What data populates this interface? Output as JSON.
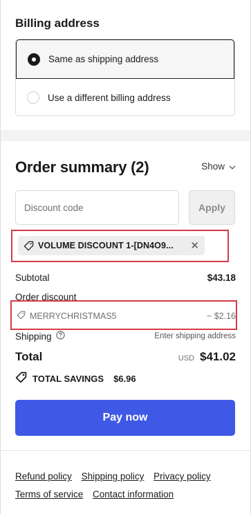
{
  "billing": {
    "title": "Billing address",
    "options": [
      {
        "label": "Same as shipping address",
        "selected": true
      },
      {
        "label": "Use a different billing address",
        "selected": false
      }
    ]
  },
  "summary": {
    "title": "Order summary (2)",
    "toggle_label": "Show",
    "discount_placeholder": "Discount code",
    "apply_label": "Apply",
    "applied_code": "VOLUME DISCOUNT 1-[DN4O9...",
    "subtotal_label": "Subtotal",
    "subtotal_value": "$43.18",
    "order_discount_label": "Order discount",
    "discount_code": "MERRYCHRISTMAS5",
    "discount_value": "− $2.16",
    "shipping_label": "Shipping",
    "shipping_value": "Enter shipping address",
    "total_label": "Total",
    "currency": "USD",
    "total_value": "$41.02",
    "savings_label": "TOTAL SAVINGS",
    "savings_value": "$6.96"
  },
  "pay_label": "Pay now",
  "footer": {
    "links": [
      "Refund policy",
      "Shipping policy",
      "Privacy policy",
      "Terms of service",
      "Contact information"
    ]
  },
  "colors": {
    "primary": "#3f59e6",
    "highlight": "#d43b45"
  },
  "icons": [
    "radio-selected",
    "radio-unselected",
    "chevron-down-icon",
    "tag-icon",
    "close-icon",
    "help-icon",
    "savings-tag-icon"
  ]
}
